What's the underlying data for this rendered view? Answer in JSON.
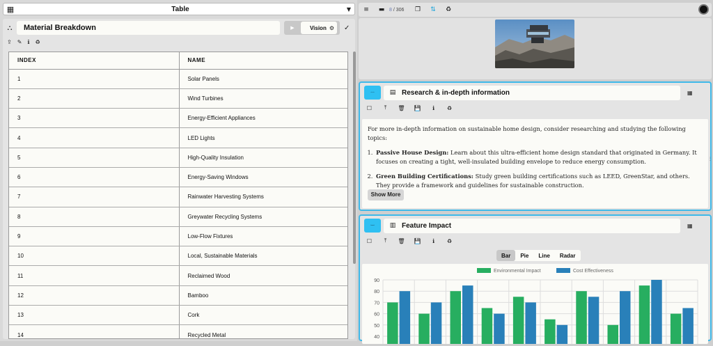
{
  "left": {
    "view_selector": {
      "value": "Table"
    },
    "title": "Material Breakdown",
    "vision_label": "Vision",
    "table": {
      "headers": [
        "INDEX",
        "NAME"
      ],
      "rows": [
        [
          "1",
          "Solar Panels"
        ],
        [
          "2",
          "Wind Turbines"
        ],
        [
          "3",
          "Energy-Efficient Appliances"
        ],
        [
          "4",
          "LED Lights"
        ],
        [
          "5",
          "High-Quality Insulation"
        ],
        [
          "6",
          "Energy-Saving Windows"
        ],
        [
          "7",
          "Rainwater Harvesting Systems"
        ],
        [
          "8",
          "Greywater Recycling Systems"
        ],
        [
          "9",
          "Low-Flow Fixtures"
        ],
        [
          "10",
          "Local, Sustainable Materials"
        ],
        [
          "11",
          "Reclaimed Wood"
        ],
        [
          "12",
          "Bamboo"
        ],
        [
          "13",
          "Cork"
        ],
        [
          "14",
          "Recycled Metal"
        ]
      ]
    }
  },
  "nav": {
    "page_current": "8",
    "page_total": "/ 306"
  },
  "research": {
    "title": "Research & in-depth information",
    "intro": "For more in-depth information on sustainable home design, consider researching and studying the following topics:",
    "items": [
      {
        "bold": "Passive House Design:",
        "text": " Learn about this ultra-efficient home design standard that originated in Germany. It focuses on creating a tight, well-insulated building envelope to reduce energy consumption."
      },
      {
        "bold": "Green Building Certifications:",
        "text": " Study green building certifications such as LEED, GreenStar, and others. They provide a framework and guidelines for sustainable construction."
      }
    ],
    "show_more": "Show More"
  },
  "impact": {
    "title": "Feature Impact",
    "chart_tabs": [
      "Bar",
      "Pie",
      "Line",
      "Radar"
    ],
    "active_tab": "Bar"
  },
  "colors": {
    "accent": "#2fc0f2",
    "series1": "#27ae60",
    "series2": "#2980b9"
  },
  "chart_data": {
    "type": "bar",
    "legend_position": "top",
    "grid": true,
    "ylim": [
      40,
      90
    ],
    "yticks": [
      "90",
      "80",
      "70",
      "60",
      "50",
      "40"
    ],
    "categories": [
      "",
      "",
      "",
      "",
      "",
      "",
      "",
      "",
      "",
      ""
    ],
    "series": [
      {
        "name": "Environmental Impact",
        "color": "#27ae60",
        "values": [
          70,
          60,
          80,
          65,
          75,
          55,
          80,
          50,
          85,
          60
        ]
      },
      {
        "name": "Cost Effectiveness",
        "color": "#2980b9",
        "values": [
          80,
          70,
          85,
          60,
          70,
          50,
          75,
          80,
          90,
          65
        ]
      }
    ]
  }
}
